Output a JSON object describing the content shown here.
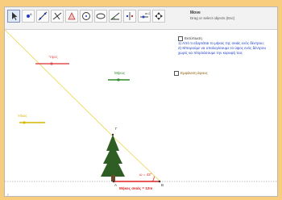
{
  "toolbar": {
    "tool_name": "Move",
    "tool_help": "Drag or select objects (Esc)",
    "tools": [
      "move-tool",
      "point-tool",
      "line-tool",
      "perpendicular-tool",
      "polygon-tool",
      "circle-tool",
      "conic-tool",
      "angle-tool",
      "reflect-tool",
      "slider-tool",
      "move-graphics-view-tool"
    ]
  },
  "sliders": {
    "s1_label": "Ύψος",
    "s2_label": "Μήκος",
    "s3_label": "Ήλιος"
  },
  "info": {
    "checkbox1_label": "Εκτύπωση",
    "q1": "1) Από τι εξαρτάται το μήκος της σκιάς ενός δέντρου;",
    "q2": "2) Μπορούμε να υπολογίσουμε το ύψος ενός δέντρου χωρίς να πλησιάσουμε την κορυφή του;",
    "checkbox2_label": "Εμφάνιση ύψους"
  },
  "figure": {
    "angle_label": "ω = 43°",
    "shadow_label": "Μήκος σκιάς = 12m",
    "point_a": "A",
    "point_b": "B",
    "point_top": "Γ"
  },
  "colors": {
    "sun_line": "#e8d64a",
    "slider_red": "#e05050",
    "slider_green": "#2e8b2e",
    "slider_yellow": "#d9b800",
    "info_blue": "#1d3fc9",
    "figure_red": "#e02020",
    "background": "#f8cd7e"
  },
  "panel": {
    "chevron": "›"
  }
}
